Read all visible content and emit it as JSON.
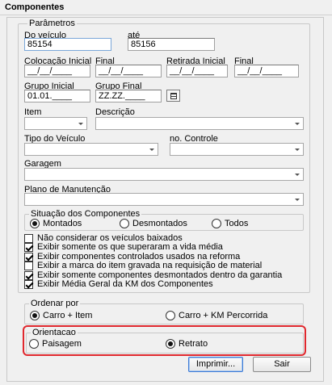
{
  "window": {
    "title": "Componentes"
  },
  "parametros": {
    "legend": "Parâmetros",
    "do_veiculo_label": "Do veículo",
    "do_veiculo_value": "85154",
    "ate_label": "até",
    "ate_value": "85156",
    "colocacao_inicial_label": "Colocação Inicial",
    "colocacao_inicial_value": "__/__/____",
    "colocacao_final_label": "Final",
    "colocacao_final_value": "__/__/____",
    "retirada_inicial_label": "Retirada Inicial",
    "retirada_inicial_value": "__/__/____",
    "retirada_final_label": "Final",
    "retirada_final_value": "__/__/____",
    "grupo_inicial_label": "Grupo Inicial",
    "grupo_inicial_value": "01.01.____",
    "grupo_final_label": "Grupo Final",
    "grupo_final_value": "ZZ.ZZ.____",
    "item_label": "Item",
    "descricao_label": "Descrição",
    "tipo_veiculo_label": "Tipo do Veículo",
    "no_controle_label": "no. Controle",
    "garagem_label": "Garagem",
    "plano_label": "Plano de Manutenção"
  },
  "situacao": {
    "legend": "Situação dos Componentes",
    "options": [
      "Montados",
      "Desmontados",
      "Todos"
    ],
    "selected": "Montados"
  },
  "checks": [
    {
      "label": "Não considerar os veículos baixados",
      "checked": false
    },
    {
      "label": "Exibir somente os que superaram a vida média",
      "checked": true
    },
    {
      "label": "Exibir componentes controlados usados na reforma",
      "checked": true
    },
    {
      "label": "Exibir a marca do item gravada na requisição de material",
      "checked": false
    },
    {
      "label": "Exibir somente componentes desmontados dentro da garantia",
      "checked": true
    },
    {
      "label": "Exibir Média Geral da KM dos Componentes",
      "checked": true
    }
  ],
  "ordenar": {
    "legend": "Ordenar por",
    "options": [
      "Carro + Item",
      "Carro + KM Percorrida"
    ],
    "selected": "Carro + Item"
  },
  "orientacao": {
    "legend": "Orientacao",
    "options": [
      "Paisagem",
      "Retrato"
    ],
    "selected": "Retrato"
  },
  "buttons": {
    "imprimir": "Imprimir...",
    "sair": "Sair"
  },
  "colors": {
    "highlight": "#e0282e",
    "default_button_border": "#3d7bd6"
  }
}
